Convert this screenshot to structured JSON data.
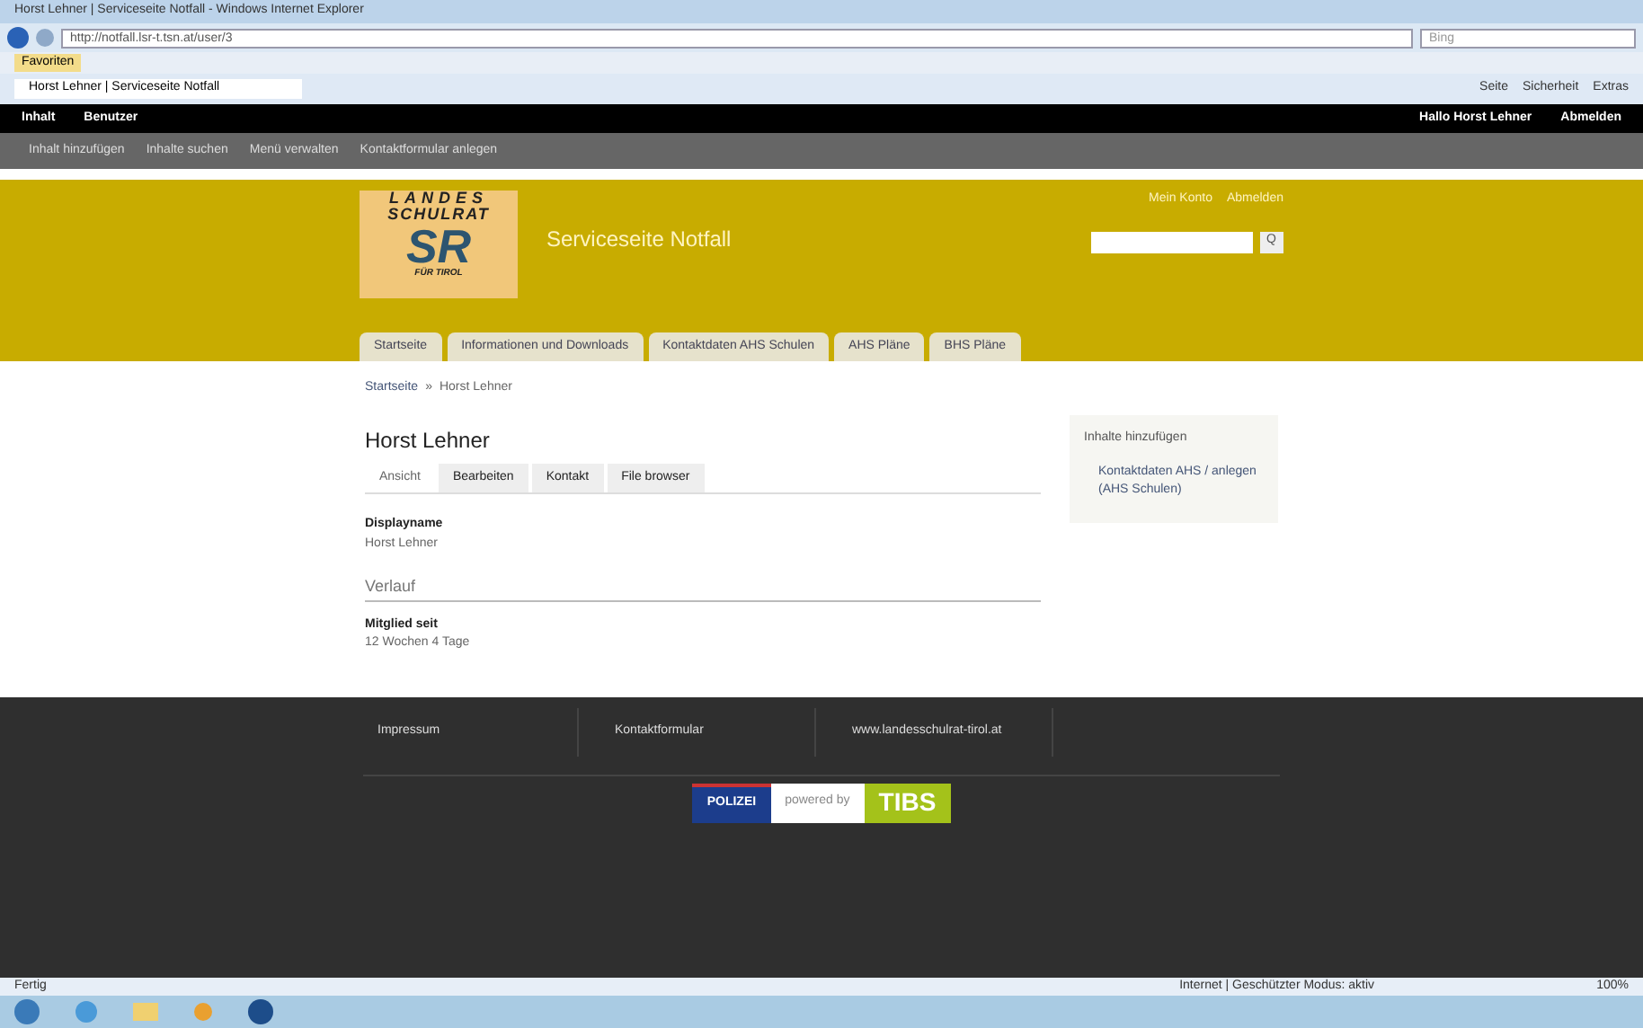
{
  "browser": {
    "title": "Horst Lehner | Serviceseite Notfall - Windows Internet Explorer",
    "address": "http://notfall.lsr-t.tsn.at/user/3",
    "search_placeholder": "Bing",
    "favorites": "Favoriten",
    "tab": "Horst Lehner | Serviceseite Notfall",
    "tools": [
      "Seite",
      "Sicherheit",
      "Extras"
    ]
  },
  "toolbar": {
    "items": [
      "Inhalt",
      "Benutzer"
    ],
    "user": "Hallo Horst Lehner",
    "logout": "Abmelden"
  },
  "shortcuts": [
    "Inhalt hinzufügen",
    "Inhalte suchen",
    "Menü verwalten",
    "Kontaktformular anlegen"
  ],
  "header": {
    "logo": {
      "line1": "LANDES",
      "line2": "SCHULRAT",
      "mark": "SR",
      "line3": "FÜR TIROL"
    },
    "site_name": "Serviceseite Notfall",
    "links": [
      "Mein Konto",
      "Abmelden"
    ],
    "search_button": "Q"
  },
  "nav": [
    {
      "label": "Startseite",
      "selected": false
    },
    {
      "label": "Informationen und Downloads",
      "selected": false
    },
    {
      "label": "Kontaktdaten AHS Schulen",
      "selected": false
    },
    {
      "label": "AHS Pläne",
      "selected": false
    },
    {
      "label": "BHS Pläne",
      "selected": false
    }
  ],
  "breadcrumb": [
    "Startseite",
    "»",
    "Horst Lehner"
  ],
  "page": {
    "title": "Horst Lehner",
    "tabs": [
      {
        "label": "Ansicht",
        "selected": true
      },
      {
        "label": "Bearbeiten",
        "selected": false
      },
      {
        "label": "Kontakt",
        "selected": false
      },
      {
        "label": "File browser",
        "selected": false
      }
    ],
    "fields": [
      {
        "label": "Displayname",
        "value": "Horst Lehner"
      }
    ],
    "section": "Verlauf",
    "history": [
      {
        "label": "Mitglied seit",
        "value": "12 Wochen 4 Tage"
      }
    ]
  },
  "sidebar": {
    "title": "Inhalte hinzufügen",
    "links": [
      "Kontaktdaten AHS / anlegen (AHS Schulen)"
    ]
  },
  "footer": {
    "links": [
      "Impressum",
      "Kontaktformular",
      "www.landesschulrat-tirol.at"
    ],
    "logos": {
      "left": "POLIZEI",
      "middle": "powered by",
      "right": "TIBS"
    }
  },
  "status": {
    "left": "Fertig",
    "zone": "Internet | Geschützter Modus: aktiv",
    "zoom": "100%"
  }
}
